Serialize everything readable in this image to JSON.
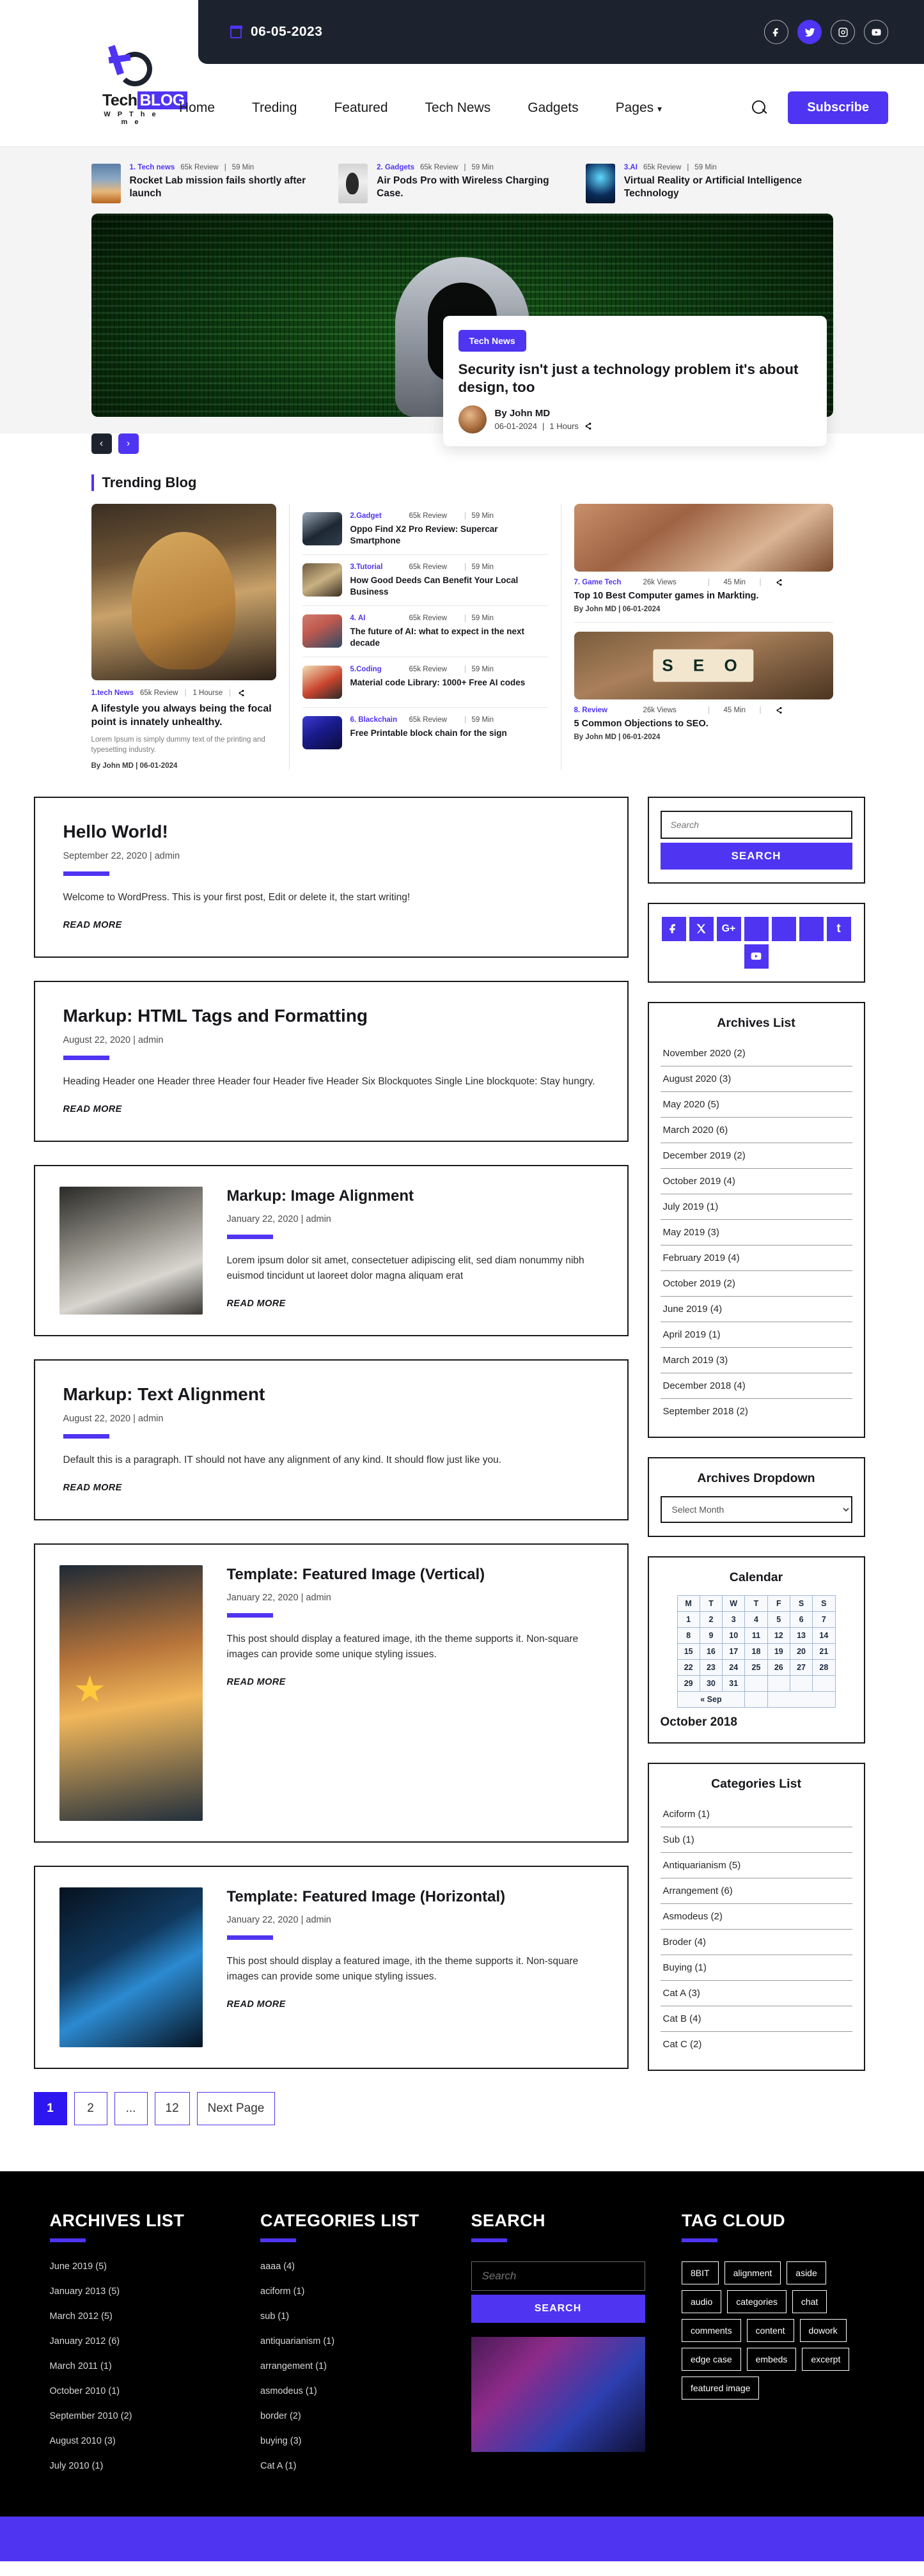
{
  "topbar": {
    "date": "06-05-2023",
    "socials": [
      "facebook",
      "twitter",
      "instagram",
      "youtube"
    ]
  },
  "brand": {
    "name_a": "Tech",
    "name_b": "BLOG",
    "tagline": "W P   T h e m e"
  },
  "nav": {
    "items": [
      {
        "label": "Home"
      },
      {
        "label": "Treding"
      },
      {
        "label": "Featured"
      },
      {
        "label": "Tech News"
      },
      {
        "label": "Gadgets"
      },
      {
        "label": "Pages",
        "caret": "⌄"
      }
    ],
    "subscribe_label": "Subscribe"
  },
  "strip": [
    {
      "cat": "1. Tech news",
      "reviews": "65k Review",
      "sep": "|",
      "time": "59 Min",
      "title": "Rocket Lab mission fails shortly after launch"
    },
    {
      "cat": "2. Gadgets",
      "reviews": "65k Review",
      "sep": "|",
      "time": "59 Min",
      "title": "Air Pods Pro with Wireless Charging Case."
    },
    {
      "cat": "3.AI",
      "reviews": "65k Review",
      "sep": "|",
      "time": "59 Min",
      "title": "Virtual Reality or Artificial Intelligence Technology"
    }
  ],
  "hero": {
    "badge": "Tech News",
    "title": "Security isn't just a technology problem it's about design, too",
    "author": "By John MD",
    "date": "06-01-2024",
    "sep": "|",
    "read_time": "1 Hours",
    "prev": "‹",
    "next": "›"
  },
  "trending": {
    "heading": "Trending Blog",
    "main": {
      "cat": "1.tech News",
      "reviews": "65k Review",
      "sep": "|",
      "time": "1 Hourse",
      "title": "A lifestyle you always being the focal point is innately unhealthy.",
      "excerpt": "Lorem Ipsum is simply dummy text of the printing and typesetting industry.",
      "by": "By John MD | 06-01-2024"
    },
    "list": [
      {
        "cat": "2.Gadget",
        "reviews": "65k Review",
        "sep": "|",
        "time": "59 Min",
        "title": "Oppo Find X2 Pro Review: Supercar Smartphone",
        "thumb": "th-oppo"
      },
      {
        "cat": "3.Tutorial",
        "reviews": "65k Review",
        "sep": "|",
        "time": "59 Min",
        "title": "How Good Deeds Can Benefit Your Local Business",
        "thumb": "th-deeds"
      },
      {
        "cat": "4. AI",
        "reviews": "65k Review",
        "sep": "|",
        "time": "59 Min",
        "title": "The future of AI: what to expect in the next decade",
        "thumb": "th-ai"
      },
      {
        "cat": "5.Coding",
        "reviews": "65k Review",
        "sep": "|",
        "time": "59 Min",
        "title": "Material code Library: 1000+ Free AI codes",
        "thumb": "th-code"
      },
      {
        "cat": "6. Blackchain",
        "reviews": "65k Review",
        "sep": "|",
        "time": "59 Min",
        "title": "Free Printable block chain for the sign",
        "thumb": "th-chain"
      }
    ],
    "cards": [
      {
        "cat": "7. Game Tech",
        "views": "26k Views",
        "sep": "|",
        "time": "45 Min",
        "title": "Top 10 Best Computer games in Markting.",
        "by": "By John MD | 06-01-2024",
        "img": "img-vr"
      },
      {
        "cat": "8. Review",
        "views": "26k Views",
        "sep": "|",
        "time": "45 Min",
        "title": "5 Common Objections to SEO.",
        "by": "By John MD | 06-01-2024",
        "img": "img-seo"
      }
    ]
  },
  "posts": [
    {
      "title": "Hello World!",
      "meta": "September 22, 2020 | admin",
      "body": "Welcome to WordPress. This is your first post, Edit or delete it, the start writing!",
      "readmore": "READ MORE",
      "layout": "text"
    },
    {
      "title": "Markup: HTML Tags and Formatting",
      "meta": "August 22, 2020 | admin",
      "body": "Heading Header one Header three Header four Header five Header Six Blockquotes Single Line blockquote: Stay hungry.",
      "readmore": "READ MORE",
      "layout": "text"
    },
    {
      "title": "Markup: Image Alignment",
      "meta": "January 22, 2020 | admin",
      "body": "Lorem ipsum dolor sit amet, consectetuer adipiscing elit, sed diam nonummy nibh euismod tincidunt ut laoreet dolor magna aliquam erat",
      "readmore": "READ MORE",
      "layout": "image",
      "img_class": "pimg-desk"
    },
    {
      "title": "Markup: Text Alignment",
      "meta": "August 22, 2020 | admin",
      "body": "Default this is a paragraph. IT should not have any alignment of any kind. It should flow just like you.",
      "readmore": "READ MORE",
      "layout": "text"
    },
    {
      "title": "Template: Featured Image (Vertical)",
      "meta": "January 22, 2020 | admin",
      "body": "This post should display a featured image, ith the theme supports it. Non-square images can provide some unique styling issues.",
      "readmore": "READ MORE",
      "layout": "image",
      "img_class": "pimg-vert"
    },
    {
      "title": "Template: Featured Image (Horizontal)",
      "meta": "January 22, 2020 | admin",
      "body": "This post should display a featured image, ith the theme supports it. Non-square images can provide some unique styling issues.",
      "readmore": "READ MORE",
      "layout": "image",
      "img_class": "pimg-horz"
    }
  ],
  "pagination": [
    {
      "label": "1",
      "active": true
    },
    {
      "label": "2",
      "active": false
    },
    {
      "label": "...",
      "active": false
    },
    {
      "label": "12",
      "active": false
    },
    {
      "label": "Next Page",
      "active": false
    }
  ],
  "sidebar": {
    "search": {
      "placeholder": "Search",
      "value": "",
      "button": "SEARCH"
    },
    "socials": [
      "facebook",
      "x-twitter",
      "google-plus",
      "blank-1",
      "blank-2",
      "blank-3",
      "tumblr",
      "youtube"
    ],
    "archives_title": "Archives List",
    "archives": [
      "November 2020 (2)",
      "August 2020 (3)",
      "May 2020 (5)",
      "March 2020 (6)",
      "December 2019 (2)",
      "October 2019 (4)",
      "July 2019 (1)",
      "May 2019 (3)",
      "February 2019 (4)",
      "October 2019 (2)",
      "June 2019 (4)",
      "April 2019 (1)",
      "March 2019 (3)",
      "December 2018 (4)",
      "September 2018 (2)"
    ],
    "dropdown_title": "Archives Dropdown",
    "dropdown_selected": "Select Month",
    "calendar": {
      "title": "Calendar",
      "days": [
        "M",
        "T",
        "W",
        "T",
        "F",
        "S",
        "S"
      ],
      "weeks": [
        [
          "1",
          "2",
          "3",
          "4",
          "5",
          "6",
          "7"
        ],
        [
          "8",
          "9",
          "10",
          "11",
          "12",
          "13",
          "14"
        ],
        [
          "15",
          "16",
          "17",
          "18",
          "19",
          "20",
          "21"
        ],
        [
          "22",
          "23",
          "24",
          "25",
          "26",
          "27",
          "28"
        ],
        [
          "29",
          "30",
          "31",
          "",
          "",
          "",
          ""
        ]
      ],
      "prev_label": "« Sep",
      "month": "October 2018"
    },
    "categories_title": "Categories List",
    "categories": [
      "Aciform (1)",
      "Sub (1)",
      "Antiquarianism (5)",
      "Arrangement (6)",
      "Asmodeus (2)",
      "Broder (4)",
      "Buying (1)",
      "Cat A (3)",
      "Cat B (4)",
      "Cat C (2)"
    ]
  },
  "footer": {
    "archives_title": "ARCHIVES LIST",
    "archives": [
      "June 2019 (5)",
      "January  2013 (5)",
      "March 2012 (5)",
      "January  2012 (6)",
      "March  2011 (1)",
      "October 2010 (1)",
      "September 2010 (2)",
      "August 2010 (3)",
      "July 2010 (1)"
    ],
    "categories_title": "CATEGORIES LIST",
    "categories": [
      "aaaa (4)",
      "aciform (1)",
      "sub (1)",
      "antiquarianism (1)",
      "arrangement (1)",
      "asmodeus (1)",
      "border (2)",
      "buying (3)",
      "Cat A (1)"
    ],
    "search_title": "SEARCH",
    "search_placeholder": "Search",
    "search_value": "",
    "search_button": "SEARCH",
    "tag_title": "TAG CLOUD",
    "tags": [
      "8BIT",
      "alignment",
      "aside",
      "audio",
      "categories",
      "chat",
      "comments",
      "content",
      "dowork",
      "edge case",
      "embeds",
      "excerpt",
      "featured image"
    ]
  },
  "colors": {
    "accent": "#4f34f2",
    "dark": "#1d232e",
    "footer_bg": "#000000"
  }
}
